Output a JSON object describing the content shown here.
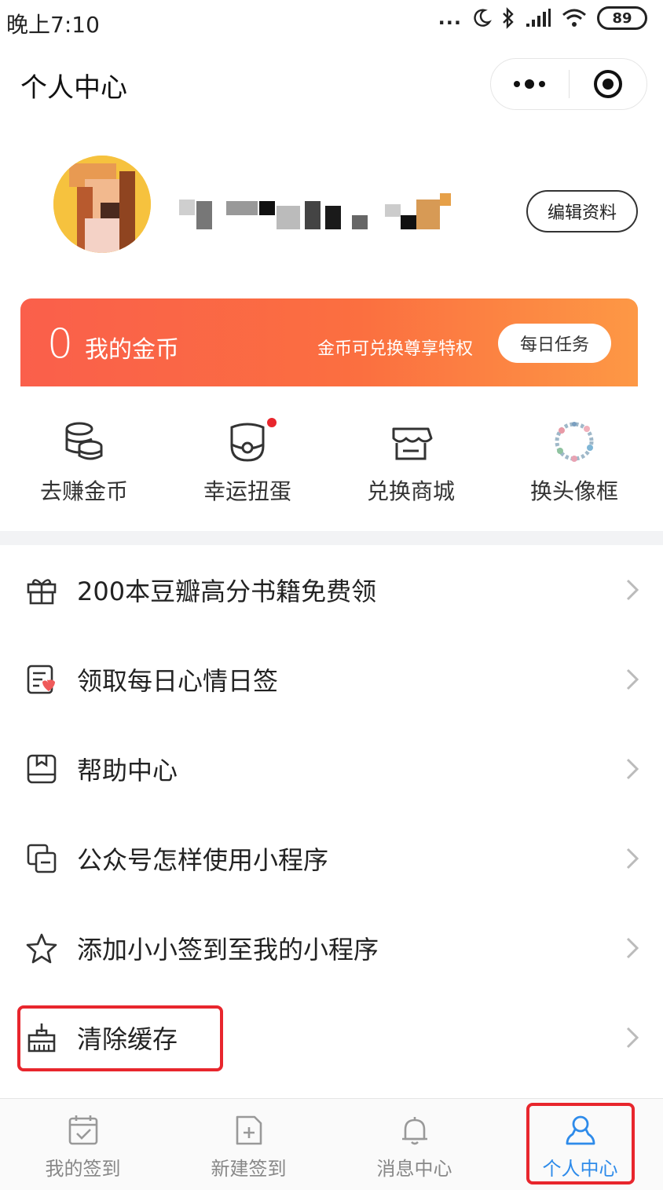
{
  "status_bar": {
    "time": "晚上7:10",
    "dots": "...",
    "battery": "89"
  },
  "header": {
    "title": "个人中心"
  },
  "profile": {
    "edit_label": "编辑资料"
  },
  "coins": {
    "count": "0",
    "label": "我的金币",
    "hint": "金币可兑换尊享特权",
    "daily_task_label": "每日任务"
  },
  "quick_actions": [
    {
      "label": "去赚金币",
      "icon": "coin-stack-icon"
    },
    {
      "label": "幸运扭蛋",
      "icon": "gacha-icon",
      "has_red_dot": true
    },
    {
      "label": "兑换商城",
      "icon": "store-icon"
    },
    {
      "label": "换头像框",
      "icon": "wreath-frame-icon"
    }
  ],
  "menu": [
    {
      "label": "200本豆瓣高分书籍免费领",
      "icon": "gift-icon"
    },
    {
      "label": "领取每日心情日签",
      "icon": "mood-note-icon"
    },
    {
      "label": "帮助中心",
      "icon": "help-book-icon"
    },
    {
      "label": "公众号怎样使用小程序",
      "icon": "copy-window-icon"
    },
    {
      "label": "添加小小签到至我的小程序",
      "icon": "star-icon"
    },
    {
      "label": "清除缓存",
      "icon": "broom-icon"
    }
  ],
  "tabbar": [
    {
      "label": "我的签到",
      "icon": "calendar-check-icon"
    },
    {
      "label": "新建签到",
      "icon": "add-file-icon"
    },
    {
      "label": "消息中心",
      "icon": "bell-icon"
    },
    {
      "label": "个人中心",
      "icon": "person-icon",
      "active": true
    }
  ],
  "colors": {
    "accent_blue": "#2e8bea",
    "highlight_red": "#e8262d",
    "banner_start": "#fa5f4b",
    "banner_end": "#fd9845"
  }
}
